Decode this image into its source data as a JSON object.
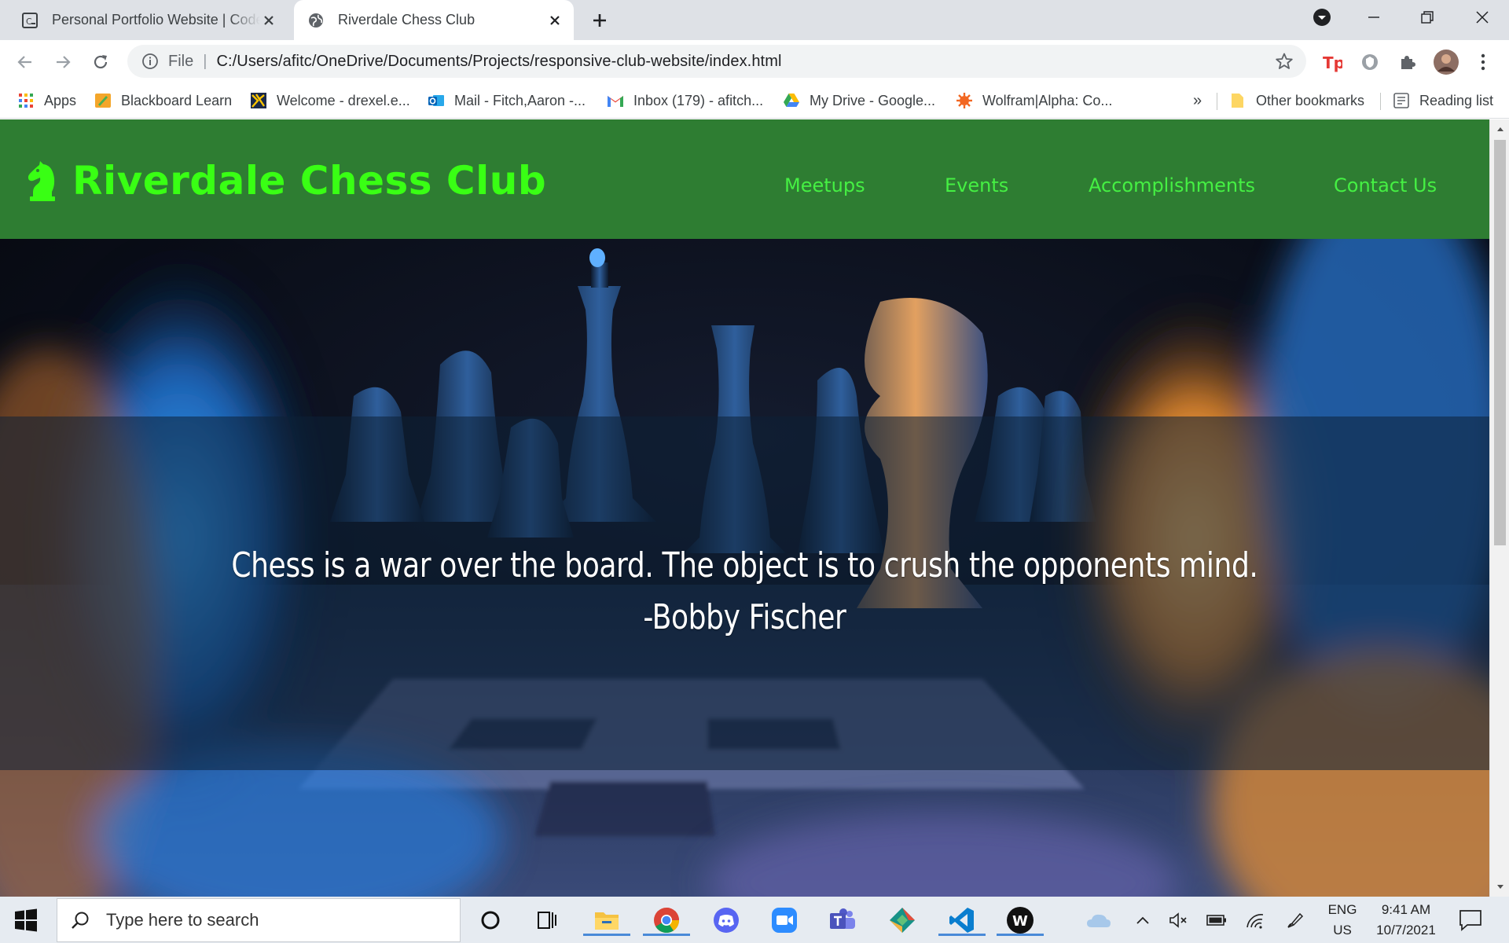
{
  "browser": {
    "tabs": [
      {
        "title": "Personal Portfolio Website | Code",
        "favicon": "codepen-icon"
      },
      {
        "title": "Riverdale Chess Club",
        "favicon": "globe-icon",
        "active": true
      }
    ],
    "omnibox": {
      "scheme_label": "File",
      "url": "C:/Users/afitc/OneDrive/Documents/Projects/responsive-club-website/index.html"
    },
    "bookmarks": [
      {
        "label": "Apps",
        "icon": "apps-grid-icon"
      },
      {
        "label": "Blackboard Learn",
        "icon": "blackboard-icon"
      },
      {
        "label": "Welcome - drexel.e...",
        "icon": "drexel-icon"
      },
      {
        "label": "Mail - Fitch,Aaron -...",
        "icon": "outlook-icon"
      },
      {
        "label": "Inbox (179) - afitch...",
        "icon": "gmail-icon"
      },
      {
        "label": "My Drive - Google...",
        "icon": "google-drive-icon"
      },
      {
        "label": "Wolfram|Alpha: Co...",
        "icon": "wolfram-icon"
      }
    ],
    "bookmarks_overflow": "»",
    "other_bookmarks": "Other bookmarks",
    "reading_list": "Reading list"
  },
  "site": {
    "brand": "Riverdale Chess Club",
    "nav": [
      "Meetups",
      "Events",
      "Accomplishments",
      "Contact Us"
    ],
    "quote": "Chess is a war over the board. The object is to crush the opponents mind.",
    "quote_author": "-Bobby Fischer"
  },
  "taskbar": {
    "search_placeholder": "Type here to search",
    "apps": [
      "cortana-icon",
      "task-view-icon",
      "file-explorer-icon",
      "chrome-icon",
      "discord-icon",
      "zoom-icon",
      "teams-icon",
      "gitkraken-icon",
      "vscode-icon",
      "webstorm-icon"
    ],
    "language_top": "ENG",
    "language_bottom": "US",
    "time": "9:41 AM",
    "date": "10/7/2021"
  },
  "colors": {
    "header_green": "#2e7d32",
    "brand_green": "#39ff14",
    "nav_green": "#45f043"
  }
}
